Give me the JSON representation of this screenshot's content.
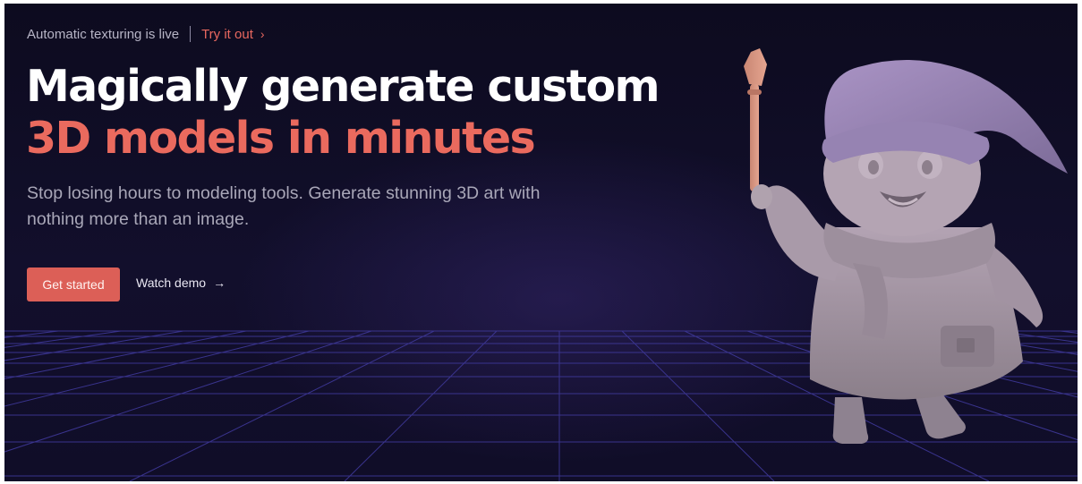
{
  "announcement": {
    "text": "Automatic texturing is live",
    "cta_label": "Try it out",
    "cta_icon": "chevron-right-icon"
  },
  "hero": {
    "headline_line1": "Magically generate custom",
    "headline_line2": "3D models in minutes",
    "subheadline": "Stop losing hours to modeling tools. Generate stunning 3D art with nothing more than an image.",
    "primary_button": "Get started",
    "secondary_button": "Watch demo",
    "secondary_icon": "arrow-right-icon"
  },
  "illustration": {
    "name": "wizard-mascot-3d-model",
    "icon": "wizard-figure"
  },
  "colors": {
    "background": "#100d28",
    "accent": "#ea6a5e",
    "button": "#dc5f57",
    "grid": "#3f3a9c",
    "headline": "#ffffff",
    "muted_text": "#a9a7b8"
  }
}
